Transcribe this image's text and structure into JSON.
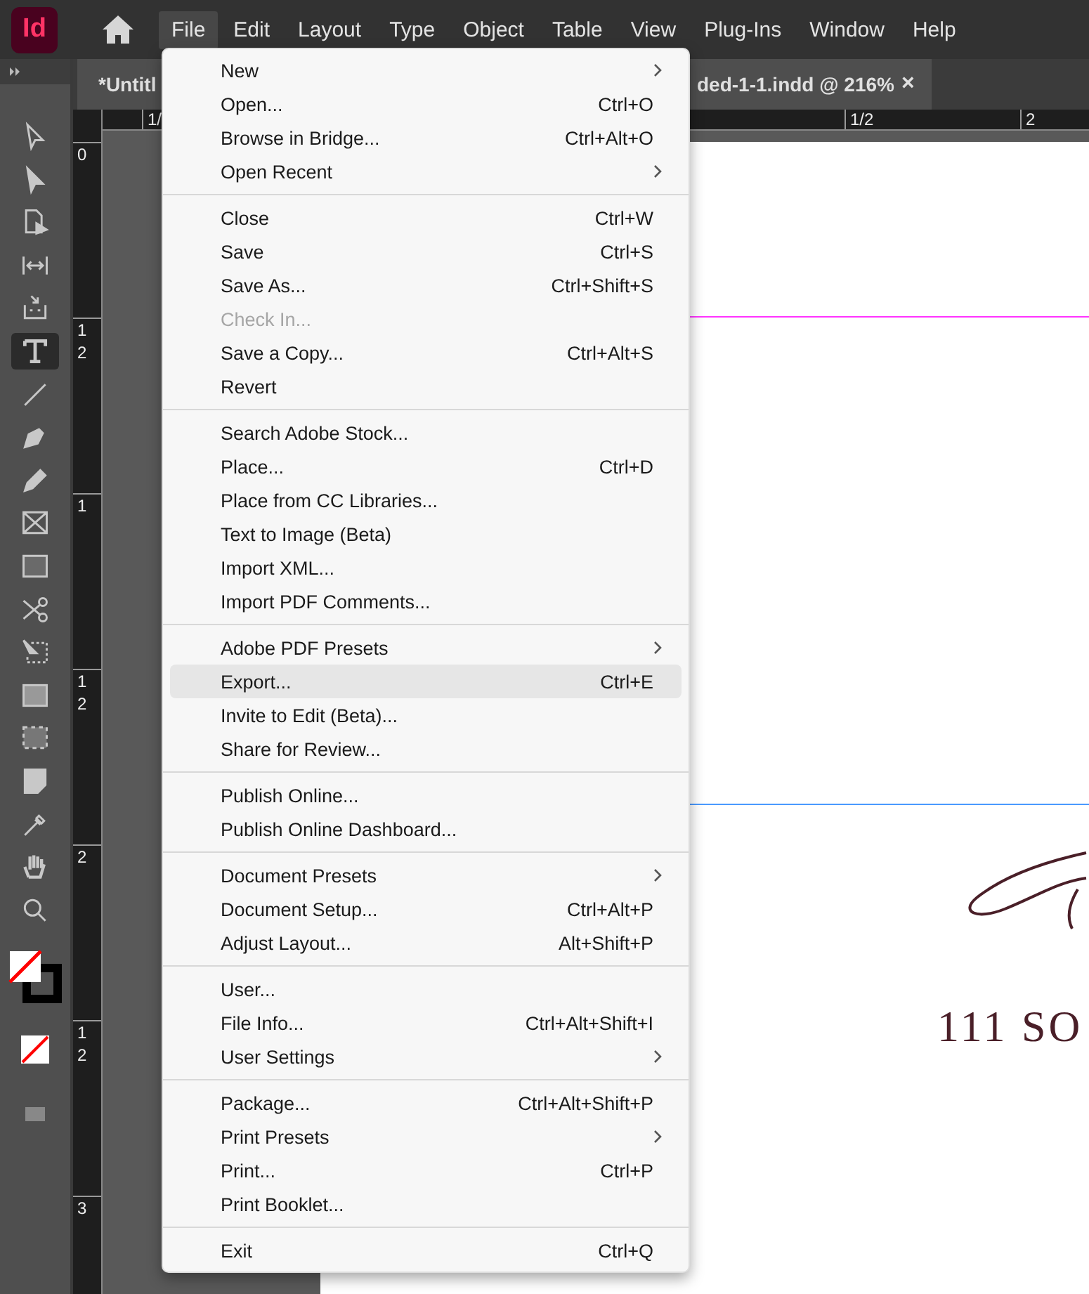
{
  "app_bar": {
    "logo": "Id",
    "menus": [
      {
        "label": "File",
        "selected": true
      },
      {
        "label": "Edit",
        "selected": false
      },
      {
        "label": "Layout",
        "selected": false
      },
      {
        "label": "Type",
        "selected": false
      },
      {
        "label": "Object",
        "selected": false
      },
      {
        "label": "Table",
        "selected": false
      },
      {
        "label": "View",
        "selected": false
      },
      {
        "label": "Plug-Ins",
        "selected": false
      },
      {
        "label": "Window",
        "selected": false
      },
      {
        "label": "Help",
        "selected": false
      }
    ]
  },
  "document_tab": {
    "label_start": "*Untitl",
    "label_end": "ded-1-1.indd @ 216%",
    "close": "×"
  },
  "horizontal_ruler": [
    "1/",
    "1/2",
    "2"
  ],
  "vertical_ruler": [
    {
      "lines": [
        "0"
      ]
    },
    {
      "lines": [
        "1",
        "2"
      ]
    },
    {
      "lines": [
        "1"
      ]
    },
    {
      "lines": [
        "1",
        "2"
      ]
    },
    {
      "lines": [
        "2"
      ]
    },
    {
      "lines": [
        "1",
        "2"
      ]
    },
    {
      "lines": [
        "3"
      ]
    }
  ],
  "tools": [
    {
      "kind": "direct-select",
      "selected": false
    },
    {
      "kind": "select",
      "selected": false
    },
    {
      "kind": "page",
      "selected": false
    },
    {
      "kind": "gap",
      "selected": false
    },
    {
      "kind": "collector",
      "selected": false
    },
    {
      "kind": "type",
      "selected": true
    },
    {
      "kind": "line",
      "selected": false
    },
    {
      "kind": "pen",
      "selected": false
    },
    {
      "kind": "pencil",
      "selected": false
    },
    {
      "kind": "frame",
      "selected": false
    },
    {
      "kind": "rect",
      "selected": false
    },
    {
      "kind": "scissors",
      "selected": false
    },
    {
      "kind": "transform",
      "selected": false
    },
    {
      "kind": "gradient",
      "selected": false
    },
    {
      "kind": "feather",
      "selected": false
    },
    {
      "kind": "note",
      "selected": false
    },
    {
      "kind": "eyedropper",
      "selected": false
    },
    {
      "kind": "hand",
      "selected": false
    },
    {
      "kind": "zoom",
      "selected": false
    }
  ],
  "page": {
    "address": "111 SO"
  },
  "file_menu": [
    [
      {
        "label": "New",
        "submenu": true,
        "disabled": false,
        "selected": false
      },
      {
        "label": "Open...",
        "shortcut": "Ctrl+O",
        "disabled": false,
        "selected": false
      },
      {
        "label": "Browse in Bridge...",
        "shortcut": "Ctrl+Alt+O",
        "disabled": false,
        "selected": false
      },
      {
        "label": "Open Recent",
        "submenu": true,
        "disabled": false,
        "selected": false
      }
    ],
    [
      {
        "label": "Close",
        "shortcut": "Ctrl+W",
        "disabled": false,
        "selected": false
      },
      {
        "label": "Save",
        "shortcut": "Ctrl+S",
        "disabled": false,
        "selected": false
      },
      {
        "label": "Save As...",
        "shortcut": "Ctrl+Shift+S",
        "disabled": false,
        "selected": false
      },
      {
        "label": "Check In...",
        "disabled": true,
        "selected": false
      },
      {
        "label": "Save a Copy...",
        "shortcut": "Ctrl+Alt+S",
        "disabled": false,
        "selected": false
      },
      {
        "label": "Revert",
        "disabled": false,
        "selected": false
      }
    ],
    [
      {
        "label": "Search Adobe Stock...",
        "disabled": false,
        "selected": false
      },
      {
        "label": "Place...",
        "shortcut": "Ctrl+D",
        "disabled": false,
        "selected": false
      },
      {
        "label": "Place from CC Libraries...",
        "disabled": false,
        "selected": false
      },
      {
        "label": "Text to Image (Beta)",
        "disabled": false,
        "selected": false
      },
      {
        "label": "Import XML...",
        "disabled": false,
        "selected": false
      },
      {
        "label": "Import PDF Comments...",
        "disabled": false,
        "selected": false
      }
    ],
    [
      {
        "label": "Adobe PDF Presets",
        "submenu": true,
        "disabled": false,
        "selected": false
      },
      {
        "label": "Export...",
        "shortcut": "Ctrl+E",
        "disabled": false,
        "selected": true
      },
      {
        "label": "Invite to Edit (Beta)...",
        "disabled": false,
        "selected": false
      },
      {
        "label": "Share for Review...",
        "disabled": false,
        "selected": false
      }
    ],
    [
      {
        "label": "Publish Online...",
        "disabled": false,
        "selected": false
      },
      {
        "label": "Publish Online Dashboard...",
        "disabled": false,
        "selected": false
      }
    ],
    [
      {
        "label": "Document Presets",
        "submenu": true,
        "disabled": false,
        "selected": false
      },
      {
        "label": "Document Setup...",
        "shortcut": "Ctrl+Alt+P",
        "disabled": false,
        "selected": false
      },
      {
        "label": "Adjust Layout...",
        "shortcut": "Alt+Shift+P",
        "disabled": false,
        "selected": false
      }
    ],
    [
      {
        "label": "User...",
        "disabled": false,
        "selected": false
      },
      {
        "label": "File Info...",
        "shortcut": "Ctrl+Alt+Shift+I",
        "disabled": false,
        "selected": false
      },
      {
        "label": "User Settings",
        "submenu": true,
        "disabled": false,
        "selected": false
      }
    ],
    [
      {
        "label": "Package...",
        "shortcut": "Ctrl+Alt+Shift+P",
        "disabled": false,
        "selected": false
      },
      {
        "label": "Print Presets",
        "submenu": true,
        "disabled": false,
        "selected": false
      },
      {
        "label": "Print...",
        "shortcut": "Ctrl+P",
        "disabled": false,
        "selected": false
      },
      {
        "label": "Print Booklet...",
        "disabled": false,
        "selected": false
      }
    ],
    [
      {
        "label": "Exit",
        "shortcut": "Ctrl+Q",
        "disabled": false,
        "selected": false
      }
    ]
  ]
}
